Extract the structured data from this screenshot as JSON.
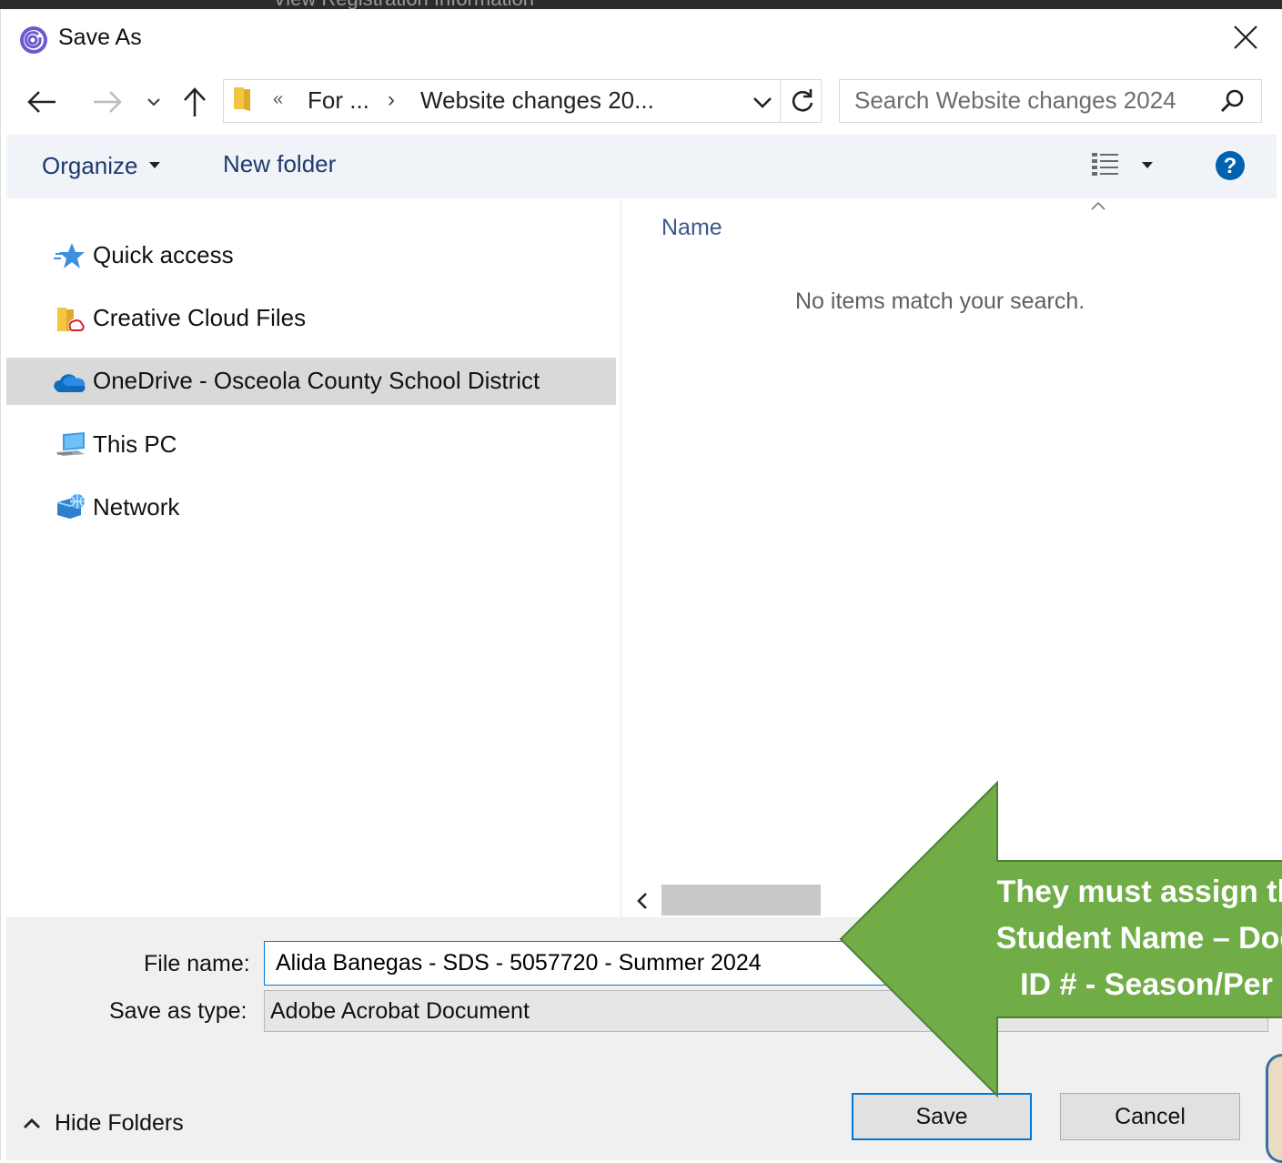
{
  "window": {
    "title": "Save As",
    "background_tabs": "View Registration Information"
  },
  "address_bar": {
    "overflow_chevron": "«",
    "segments": [
      "For ...",
      "Website changes 20..."
    ],
    "separator": "›"
  },
  "search": {
    "placeholder": "Search Website changes 2024"
  },
  "toolbar": {
    "organize_label": "Organize",
    "new_folder_label": "New folder"
  },
  "nav_pane": {
    "items": [
      {
        "label": "Quick access",
        "icon": "star-icon"
      },
      {
        "label": "Creative Cloud Files",
        "icon": "creative-cloud-folder-icon"
      },
      {
        "label": "OneDrive - Osceola County School District",
        "icon": "onedrive-cloud-icon",
        "selected": true
      },
      {
        "label": "This PC",
        "icon": "computer-icon"
      },
      {
        "label": "Network",
        "icon": "network-icon"
      }
    ]
  },
  "file_list": {
    "column_name": "Name",
    "empty_message": "No items match your search."
  },
  "form": {
    "file_name_label": "File name:",
    "file_name_value": "Alida Banegas - SDS - 5057720 - Summer 2024",
    "save_as_type_label": "Save as type:",
    "save_as_type_value": "Adobe Acrobat Document"
  },
  "footer": {
    "hide_folders_label": "Hide Folders",
    "save_label": "Save",
    "cancel_label": "Cancel"
  },
  "annotation": {
    "lines": [
      "They must assign th",
      "Student Name – Doc",
      "ID # - Season/Per"
    ],
    "arrow_color": "#70ad47",
    "arrow_border": "#507e32"
  },
  "colors": {
    "accent": "#0078d7",
    "selected_bg": "#d9d9d9",
    "toolbar_bg": "#f0f3f8",
    "help_blue": "#0063b1"
  }
}
